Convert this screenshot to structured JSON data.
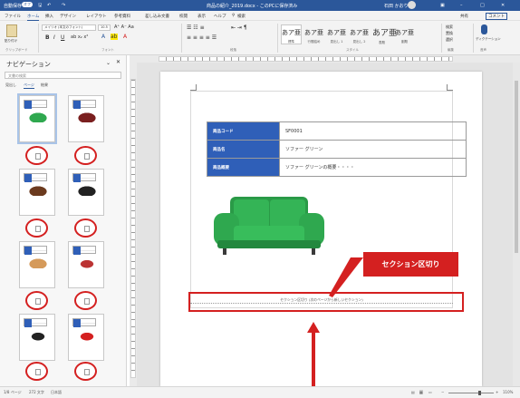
{
  "titlebar": {
    "autosave": "自動保存",
    "autosave_state": "オフ",
    "doc_title": "商品の紹介_2019.docx - このPCに保存済み",
    "user": "石田 かおり"
  },
  "menu": {
    "tabs": [
      "ファイル",
      "ホーム",
      "挿入",
      "デザイン",
      "レイアウト",
      "参考資料",
      "差し込み文書",
      "校閲",
      "表示",
      "ヘルプ",
      "検索"
    ],
    "share": "共有",
    "comment": "コメント"
  },
  "ribbon": {
    "groups": {
      "clipboard": "クリップボード",
      "font": "フォント",
      "paragraph": "段落",
      "styles": "スタイル",
      "editing": "編集",
      "voice": "音声"
    },
    "paste": "貼り付け",
    "font_name": "メイリオ (本文のフォント)",
    "font_size": "10.5",
    "styles": [
      {
        "sample": "あア亜",
        "name": "標準"
      },
      {
        "sample": "あア亜",
        "name": "行間詰め"
      },
      {
        "sample": "あア亜",
        "name": "見出し 1"
      },
      {
        "sample": "あア亜",
        "name": "見出し 2"
      },
      {
        "sample": "あア亜",
        "name": "表題"
      },
      {
        "sample": "あア亜",
        "name": "副題"
      }
    ],
    "find": "検索",
    "replace": "置換",
    "select": "選択",
    "dictate": "ディクテーション"
  },
  "nav": {
    "title": "ナビゲーション",
    "search_placeholder": "文書の検索",
    "tabs": [
      "見出し",
      "ページ",
      "結果"
    ]
  },
  "document": {
    "table": [
      {
        "label": "商品コード",
        "value": "SF0001"
      },
      {
        "label": "商品名",
        "value": "ソファー グリーン"
      },
      {
        "label": "商品概要",
        "value": "ソファー グリーンの概要・・・・"
      }
    ],
    "section_break": "セクション区切り (次のページから新しいセクション)",
    "callout": "セクション区切り"
  },
  "status": {
    "page": "1/8 ページ",
    "words": "272 文字",
    "lang": "日本語",
    "zoom": "110%"
  },
  "colors": {
    "title_blue": "#2b579a",
    "table_header": "#2f5fb8",
    "callout_red": "#d42020",
    "sofa_green": "#2fa84f"
  }
}
